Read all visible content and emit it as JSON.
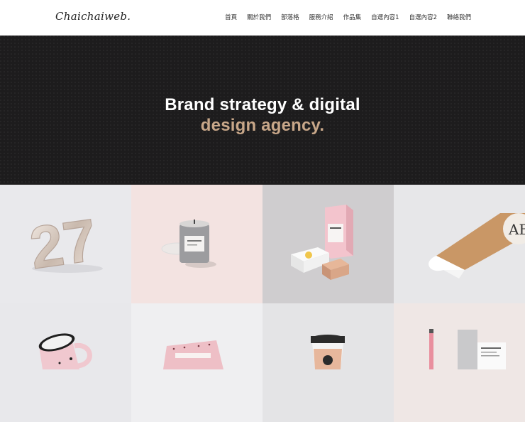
{
  "header": {
    "logo": "Chaichaiweb.",
    "nav": [
      "首頁",
      "關於我們",
      "部落格",
      "服務介紹",
      "作品集",
      "自選內容1",
      "自選內容2",
      "聯絡我們"
    ]
  },
  "hero": {
    "line1": "Brand strategy & digital",
    "line2": "design agency."
  },
  "colors": {
    "hero_bg": "#1d1c1d",
    "accent": "#c8a789"
  },
  "portfolio": [
    {
      "icon": "balloon-27-icon",
      "number_text": "27"
    },
    {
      "icon": "candle-jar-icon"
    },
    {
      "icon": "pink-box-stationery-icon"
    },
    {
      "icon": "kraft-tube-ab-icon",
      "logo_text": "AB"
    },
    {
      "icon": "pink-mug-icon"
    },
    {
      "icon": "pink-pouch-icon"
    },
    {
      "icon": "coffee-cup-icon"
    },
    {
      "icon": "stationery-set-icon"
    }
  ]
}
